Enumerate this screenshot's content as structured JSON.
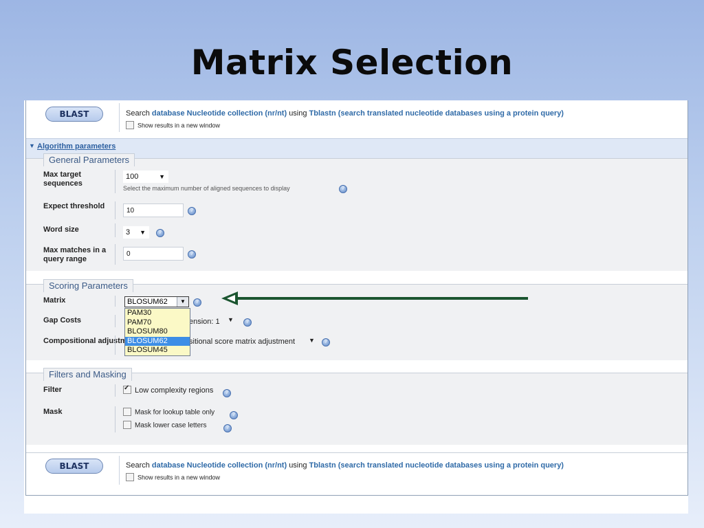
{
  "slide": {
    "title": "Matrix Selection"
  },
  "blast_top": {
    "button_label": "BLAST",
    "search_prefix": "Search",
    "database_text": "database Nucleotide collection (nr/nt)",
    "using_text": "using",
    "program_text": "Tblastn (search translated nucleotide databases using a protein query)",
    "new_window_label": "Show results in a new window"
  },
  "algorithm": {
    "toggle_label": "Algorithm parameters"
  },
  "general": {
    "legend": "General Parameters",
    "max_target_label": "Max target sequences",
    "max_target_value": "100",
    "max_target_hint": "Select the maximum number of aligned sequences to display",
    "expect_label": "Expect threshold",
    "expect_value": "10",
    "word_size_label": "Word size",
    "word_size_value": "3",
    "max_matches_label": "Max matches in a query range",
    "max_matches_value": "0"
  },
  "scoring": {
    "legend": "Scoring Parameters",
    "matrix_label": "Matrix",
    "matrix_value": "BLOSUM62",
    "matrix_options": [
      "PAM30",
      "PAM70",
      "BLOSUM80",
      "BLOSUM62",
      "BLOSUM45"
    ],
    "highlighted_option": "BLOSUM62",
    "gap_costs_label": "Gap Costs",
    "gap_costs_value": "ension: 1",
    "compositional_label": "Compositional adjustments",
    "compositional_value": "sitional score matrix adjustment"
  },
  "filters": {
    "legend": "Filters and Masking",
    "filter_label": "Filter",
    "low_complexity_label": "Low complexity regions",
    "low_complexity_checked": true,
    "mask_label": "Mask",
    "mask_lookup_label": "Mask for lookup table only",
    "mask_lower_label": "Mask lower case letters"
  },
  "blast_bottom": {
    "button_label": "BLAST",
    "search_prefix": "Search",
    "database_text": "database Nucleotide collection (nr/nt)",
    "using_text": "using",
    "program_text": "Tblastn (search translated nucleotide databases using a protein query)",
    "new_window_label": "Show results in a new window"
  },
  "colors": {
    "arrow": "#1b5530",
    "link": "#2f6aa7",
    "highlight": "#3d8ee6",
    "dropdown_bg": "#fbf9c6"
  }
}
